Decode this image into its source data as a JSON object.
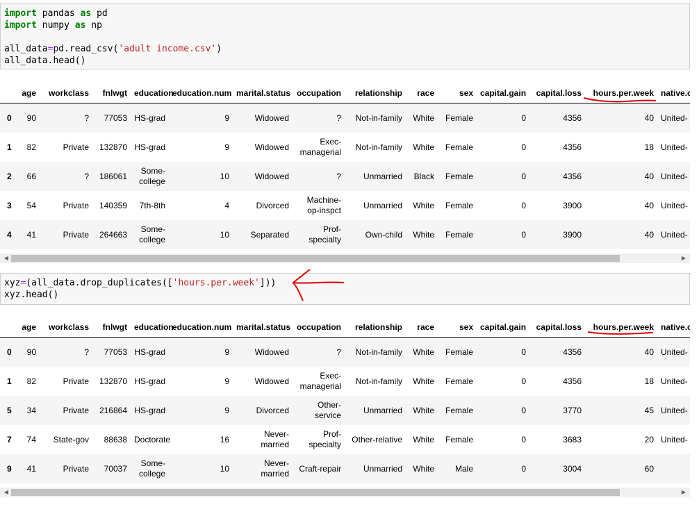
{
  "cell1": {
    "lines": [
      [
        {
          "t": "import",
          "c": "kw"
        },
        {
          "t": " pandas "
        },
        {
          "t": "as",
          "c": "kw"
        },
        {
          "t": " pd"
        }
      ],
      [
        {
          "t": "import",
          "c": "kw"
        },
        {
          "t": " numpy "
        },
        {
          "t": "as",
          "c": "kw"
        },
        {
          "t": " np"
        }
      ],
      [],
      [
        {
          "t": "all_data"
        },
        {
          "t": "=",
          "c": "op"
        },
        {
          "t": "pd.read_csv("
        },
        {
          "t": "'adult income.csv'",
          "c": "str"
        },
        {
          "t": ")"
        }
      ],
      [
        {
          "t": "all_data.head()"
        }
      ]
    ]
  },
  "cell2": {
    "lines": [
      [
        {
          "t": "xyz"
        },
        {
          "t": "=",
          "c": "op"
        },
        {
          "t": "(all_data.drop_duplicates(["
        },
        {
          "t": "'hours.per.week'",
          "c": "str"
        },
        {
          "t": "]))"
        }
      ],
      [
        {
          "t": "xyz.head()"
        }
      ]
    ]
  },
  "columns": [
    "",
    "age",
    "workclass",
    "fnlwgt",
    "education",
    "education.num",
    "marital.status",
    "occupation",
    "relationship",
    "race",
    "sex",
    "capital.gain",
    "capital.loss",
    "hours.per.week",
    "native.c"
  ],
  "table1": [
    [
      "0",
      "90",
      "?",
      "77053",
      "HS-grad",
      "9",
      "Widowed",
      "?",
      "Not-in-family",
      "White",
      "Female",
      "0",
      "4356",
      "40",
      "United-"
    ],
    [
      "1",
      "82",
      "Private",
      "132870",
      "HS-grad",
      "9",
      "Widowed",
      "Exec-managerial",
      "Not-in-family",
      "White",
      "Female",
      "0",
      "4356",
      "18",
      "United-"
    ],
    [
      "2",
      "66",
      "?",
      "186061",
      "Some-college",
      "10",
      "Widowed",
      "?",
      "Unmarried",
      "Black",
      "Female",
      "0",
      "4356",
      "40",
      "United-"
    ],
    [
      "3",
      "54",
      "Private",
      "140359",
      "7th-8th",
      "4",
      "Divorced",
      "Machine-op-inspct",
      "Unmarried",
      "White",
      "Female",
      "0",
      "3900",
      "40",
      "United-"
    ],
    [
      "4",
      "41",
      "Private",
      "264663",
      "Some-college",
      "10",
      "Separated",
      "Prof-specialty",
      "Own-child",
      "White",
      "Female",
      "0",
      "3900",
      "40",
      "United-"
    ]
  ],
  "table2": [
    [
      "0",
      "90",
      "?",
      "77053",
      "HS-grad",
      "9",
      "Widowed",
      "?",
      "Not-in-family",
      "White",
      "Female",
      "0",
      "4356",
      "40",
      "United-"
    ],
    [
      "1",
      "82",
      "Private",
      "132870",
      "HS-grad",
      "9",
      "Widowed",
      "Exec-managerial",
      "Not-in-family",
      "White",
      "Female",
      "0",
      "4356",
      "18",
      "United-"
    ],
    [
      "5",
      "34",
      "Private",
      "216864",
      "HS-grad",
      "9",
      "Divorced",
      "Other-service",
      "Unmarried",
      "White",
      "Female",
      "0",
      "3770",
      "45",
      "United-"
    ],
    [
      "7",
      "74",
      "State-gov",
      "88638",
      "Doctorate",
      "16",
      "Never-married",
      "Prof-specialty",
      "Other-relative",
      "White",
      "Female",
      "0",
      "3683",
      "20",
      "United-"
    ],
    [
      "9",
      "41",
      "Private",
      "70037",
      "Some-college",
      "10",
      "Never-married",
      "Craft-repair",
      "Unmarried",
      "White",
      "Male",
      "0",
      "3004",
      "60",
      ""
    ]
  ],
  "scrollbar": {
    "left_arrow": "◀",
    "right_arrow": "▶"
  },
  "colors": {
    "annotation": "#e00000",
    "keyword": "#008000",
    "string": "#ba2121",
    "operator": "#aa22ff"
  }
}
